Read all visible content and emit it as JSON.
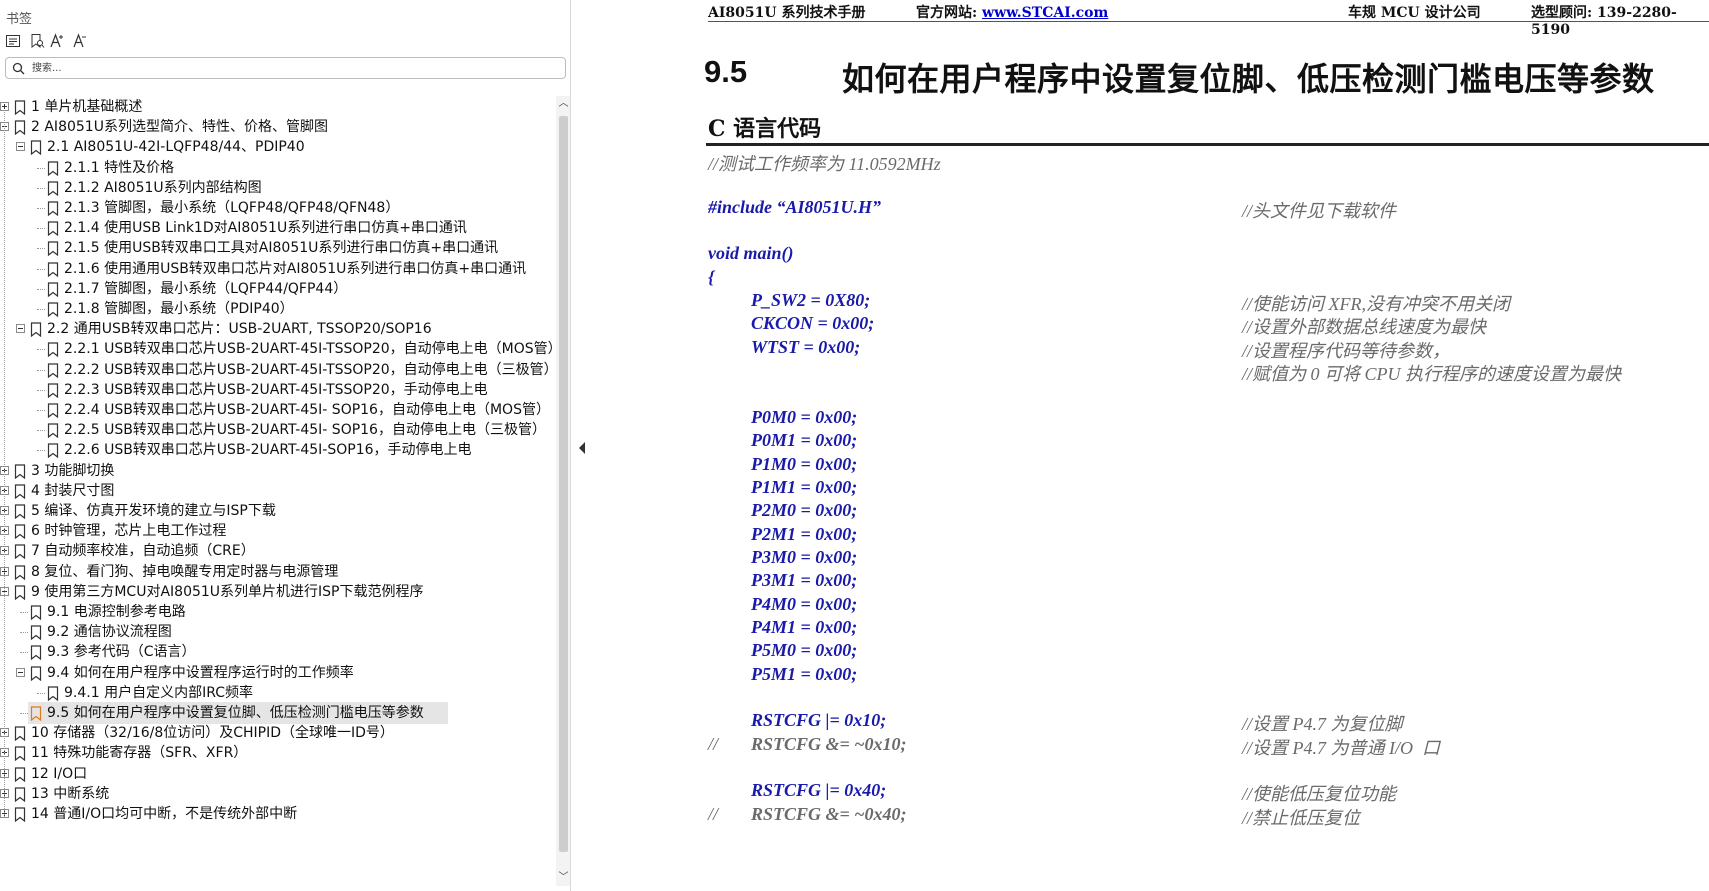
{
  "sidebar": {
    "title": "书签",
    "toolbar": [
      "expand-all-icon",
      "bookmark-search-icon",
      "font-increase-icon",
      "font-decrease-icon"
    ],
    "search_placeholder": "搜索...",
    "tree": [
      {
        "label": "1 单片机基础概述",
        "level": 0,
        "expander": "plus"
      },
      {
        "label": "2  AI8051U系列选型简介、特性、价格、管脚图",
        "level": 0,
        "expander": "minus"
      },
      {
        "label": "2.1 AI8051U-42I-LQFP48/44、PDIP40",
        "level": 1,
        "expander": "minus"
      },
      {
        "label": "2.1.1 特性及价格",
        "level": 2
      },
      {
        "label": "2.1.2  AI8051U系列内部结构图",
        "level": 2
      },
      {
        "label": "2.1.3 管脚图，最小系统（LQFP48/QFP48/QFN48）",
        "level": 2
      },
      {
        "label": "2.1.4  使用USB Link1D对AI8051U系列进行串口仿真+串口通讯",
        "level": 2
      },
      {
        "label": "2.1.5 使用USB转双串口工具对AI8051U系列进行串口仿真+串口通讯",
        "level": 2
      },
      {
        "label": "2.1.6 使用通用USB转双串口芯片对AI8051U系列进行串口仿真+串口通讯",
        "level": 2
      },
      {
        "label": "2.1.7 管脚图，最小系统（LQFP44/QFP44）",
        "level": 2
      },
      {
        "label": "2.1.8  管脚图，最小系统（PDIP40）",
        "level": 2
      },
      {
        "label": "2.2  通用USB转双串口芯片：USB-2UART, TSSOP20/SOP16",
        "level": 1,
        "expander": "minus"
      },
      {
        "label": "2.2.1 USB转双串口芯片USB-2UART-45I-TSSOP20，自动停电上电（MOS管）",
        "level": 2
      },
      {
        "label": "2.2.2  USB转双串口芯片USB-2UART-45I-TSSOP20，自动停电上电（三极管）",
        "level": 2
      },
      {
        "label": "2.2.3 USB转双串口芯片USB-2UART-45I-TSSOP20，手动停电上电",
        "level": 2
      },
      {
        "label": "2.2.4  USB转双串口芯片USB-2UART-45I- SOP16，自动停电上电（MOS管）",
        "level": 2
      },
      {
        "label": "2.2.5  USB转双串口芯片USB-2UART-45I- SOP16，自动停电上电（三极管）",
        "level": 2
      },
      {
        "label": "2.2.6  USB转双串口芯片USB-2UART-45I-SOP16，手动停电上电",
        "level": 2
      },
      {
        "label": "3  功能脚切换",
        "level": 0,
        "expander": "plus"
      },
      {
        "label": "4  封装尺寸图",
        "level": 0,
        "expander": "plus"
      },
      {
        "label": "5  编译、仿真开发环境的建立与ISP下载",
        "level": 0,
        "expander": "plus"
      },
      {
        "label": "6  时钟管理，芯片上电工作过程",
        "level": 0,
        "expander": "plus"
      },
      {
        "label": "7  自动频率校准，自动追频（CRE）",
        "level": 0,
        "expander": "plus"
      },
      {
        "label": "8  复位、看门狗、掉电唤醒专用定时器与电源管理",
        "level": 0,
        "expander": "plus"
      },
      {
        "label": "9  使用第三方MCU对AI8051U系列单片机进行ISP下载范例程序",
        "level": 0,
        "expander": "minus"
      },
      {
        "label": "9.1 电源控制参考电路",
        "level": 1
      },
      {
        "label": "9.2  通信协议流程图",
        "level": 1
      },
      {
        "label": "9.3  参考代码（C语言）",
        "level": 1
      },
      {
        "label": "9.4  如何在用户程序中设置程序运行时的工作频率",
        "level": 1,
        "expander": "minus"
      },
      {
        "label": "9.4.1 用户自定义内部IRC频率",
        "level": 2
      },
      {
        "label": "9.5  如何在用户程序中设置复位脚、低压检测门槛电压等参数",
        "level": 1,
        "selected": true
      },
      {
        "label": "10  存储器（32/16/8位访问）及CHIPID（全球唯一ID号）",
        "level": 0,
        "expander": "plus"
      },
      {
        "label": "11  特殊功能寄存器（SFR、XFR）",
        "level": 0,
        "expander": "plus"
      },
      {
        "label": "12  I/O口",
        "level": 0,
        "expander": "plus"
      },
      {
        "label": "13  中断系统",
        "level": 0,
        "expander": "plus"
      },
      {
        "label": "14  普通I/O口均可中断，不是传统外部中断",
        "level": 0,
        "expander": "plus"
      }
    ]
  },
  "doc": {
    "header": {
      "manual": "AI8051U 系列技术手册",
      "site_label": "官方网站: ",
      "site_url": "www.STCAI.com",
      "company": "车规 MCU 设计公司",
      "consult": "选型顾问: 139-2280-5190"
    },
    "section_number": "9.5",
    "section_title": "如何在用户程序中设置复位脚、低压检测门槛电压等参数",
    "subtitle": "C 语言代码",
    "code": [
      {
        "text": "//测试工作频率为 11.0592MHz",
        "indent": 0,
        "kind": "comment-line"
      },
      {
        "text": "",
        "indent": 0
      },
      {
        "text": "#include “AI8051U.H”",
        "indent": 0,
        "comment": "//头文件见下载软件"
      },
      {
        "text": "",
        "indent": 0
      },
      {
        "text": "void main()",
        "indent": 0
      },
      {
        "text": "{",
        "indent": 0
      },
      {
        "text": "P_SW2 = 0X80;",
        "indent": 1,
        "comment": "//使能访问 XFR,没有冲突不用关闭"
      },
      {
        "text": "CKCON = 0x00;",
        "indent": 1,
        "comment": "//设置外部数据总线速度为最快"
      },
      {
        "text": "WTST = 0x00;",
        "indent": 1,
        "comment": "//设置程序代码等待参数，"
      },
      {
        "text": "",
        "indent": 1,
        "comment": "//赋值为 0 可将 CPU 执行程序的速度设置为最快"
      },
      {
        "text": "",
        "indent": 1
      },
      {
        "text": "P0M0 = 0x00;",
        "indent": 1
      },
      {
        "text": "P0M1 = 0x00;",
        "indent": 1
      },
      {
        "text": "P1M0 = 0x00;",
        "indent": 1
      },
      {
        "text": "P1M1 = 0x00;",
        "indent": 1
      },
      {
        "text": "P2M0 = 0x00;",
        "indent": 1
      },
      {
        "text": "P2M1 = 0x00;",
        "indent": 1
      },
      {
        "text": "P3M0 = 0x00;",
        "indent": 1
      },
      {
        "text": "P3M1 = 0x00;",
        "indent": 1
      },
      {
        "text": "P4M0 = 0x00;",
        "indent": 1
      },
      {
        "text": "P4M1 = 0x00;",
        "indent": 1
      },
      {
        "text": "P5M0 = 0x00;",
        "indent": 1
      },
      {
        "text": "P5M1 = 0x00;",
        "indent": 1
      },
      {
        "text": "",
        "indent": 1
      },
      {
        "text": "RSTCFG |= 0x10;",
        "indent": 1,
        "comment": "//设置 P4.7 为复位脚"
      },
      {
        "text": "RSTCFG &= ~0x10;",
        "indent": 1,
        "prefix": "//",
        "disabled": true,
        "comment": "//设置 P4.7 为普通 I/O  口"
      },
      {
        "text": "",
        "indent": 1
      },
      {
        "text": "RSTCFG |= 0x40;",
        "indent": 1,
        "comment": "//使能低压复位功能"
      },
      {
        "text": "RSTCFG &= ~0x40;",
        "indent": 1,
        "prefix": "//",
        "disabled": true,
        "comment": "//禁止低压复位"
      }
    ]
  }
}
